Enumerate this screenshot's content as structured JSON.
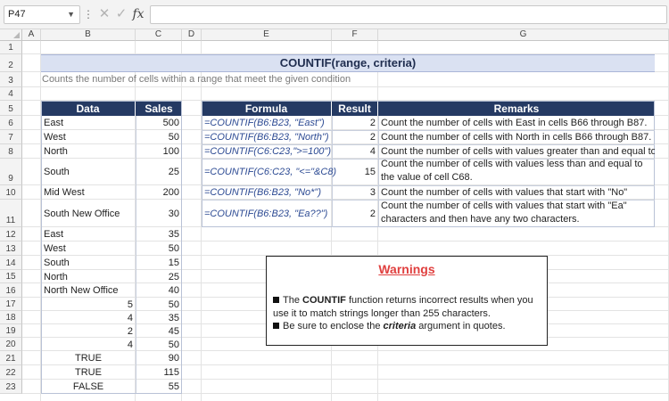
{
  "formula_bar": {
    "name_box": "P47",
    "fx_label": "fx",
    "formula_value": ""
  },
  "columns": [
    "A",
    "B",
    "C",
    "D",
    "E",
    "F",
    "G"
  ],
  "rows": [
    "1",
    "2",
    "3",
    "4",
    "5",
    "6",
    "7",
    "8",
    "9",
    "10",
    "11",
    "12",
    "13",
    "14",
    "15",
    "16",
    "17",
    "18",
    "19",
    "20",
    "21",
    "22",
    "23"
  ],
  "sheet": {
    "title": "COUNTIF(range, criteria)",
    "subtitle": "Counts the number of cells within a range that meet the given condition",
    "data_table": {
      "headers": {
        "data": "Data",
        "sales": "Sales"
      },
      "rows": [
        {
          "data": "East",
          "sales": "500"
        },
        {
          "data": "West",
          "sales": "50"
        },
        {
          "data": "North",
          "sales": "100"
        },
        {
          "data": "South",
          "sales": "25"
        },
        {
          "data": "Mid West",
          "sales": "200"
        },
        {
          "data": "South New Office",
          "sales": "30"
        },
        {
          "data": "East",
          "sales": "35"
        },
        {
          "data": "West",
          "sales": "50"
        },
        {
          "data": "South",
          "sales": "15"
        },
        {
          "data": "North",
          "sales": "25"
        },
        {
          "data": "North New Office",
          "sales": "40"
        },
        {
          "data": "5",
          "sales": "50"
        },
        {
          "data": "4",
          "sales": "35"
        },
        {
          "data": "2",
          "sales": "45"
        },
        {
          "data": "4",
          "sales": "50"
        },
        {
          "data": "TRUE",
          "sales": "90"
        },
        {
          "data": "TRUE",
          "sales": "115"
        },
        {
          "data": "FALSE",
          "sales": "55"
        }
      ]
    },
    "formula_table": {
      "headers": {
        "formula": "Formula",
        "result": "Result",
        "remarks": "Remarks"
      },
      "rows": [
        {
          "formula": "=COUNTIF(B6:B23, \"East\")",
          "result": "2",
          "remarks": "Count the number of cells with East in cells B66 through B87."
        },
        {
          "formula": "=COUNTIF(B6:B23, \"North\")",
          "result": "2",
          "remarks": "Count the number of cells with North in cells B66 through B87."
        },
        {
          "formula": "=COUNTIF(C6:C23,\">=100\")",
          "result": "4",
          "remarks": "Count the number of cells with values greater than and equal to"
        },
        {
          "formula": "=COUNTIF(C6:C23, \"<=\"&C8)",
          "result": "15",
          "remarks": "Count the number of cells with values less than and equal to the value of cell C68."
        },
        {
          "formula": "=COUNTIF(B6:B23, \"No*\")",
          "result": "3",
          "remarks": "Count the number of cells with values that start with \"No\""
        },
        {
          "formula": "=COUNTIF(B6:B23, \"Ea??\")",
          "result": "2",
          "remarks": "Count the number of cells with values that start with \"Ea\" characters and then have any two characters."
        }
      ]
    },
    "warnings": {
      "title": "Warnings",
      "item1_pre": "The ",
      "item1_bold": "COUNTIF",
      "item1_post": " function returns incorrect results when you use it to match strings longer than 255 characters.",
      "item2_pre": "Be sure to enclose the ",
      "item2_bold": "criteria",
      "item2_post": " argument in quotes."
    }
  }
}
